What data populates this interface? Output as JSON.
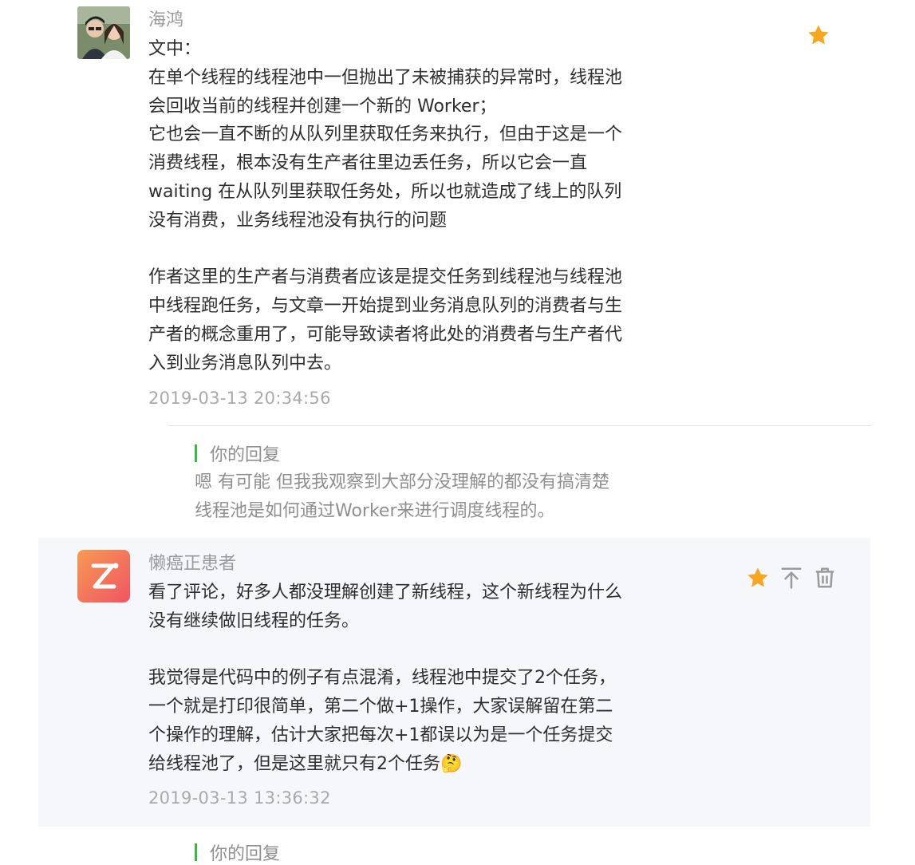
{
  "comments": [
    {
      "author": "海鸿",
      "content": "文中：\n在单个线程的线程池中一但抛出了未被捕获的异常时，线程池会回收当前的线程并创建一个新的 Worker；\n它也会一直不断的从队列里获取任务来执行，但由于这是一个消费线程，根本没有生产者往里边丢任务，所以它会一直 waiting 在从队列里获取任务处，所以也就造成了线上的队列没有消费，业务线程池没有执行的问题\n\n作者这里的生产者与消费者应该是提交任务到线程池与线程池中线程跑任务，与文章一开始提到业务消息队列的消费者与生产者的概念重用了，可能导致读者将此处的消费者与生产者代入到业务消息队列中去。",
      "time": "2019-03-13 20:34:56",
      "reply": {
        "label": "你的回复",
        "text": "嗯 有可能 但我我观察到大部分没理解的都没有搞清楚\n线程池是如何通过Worker来进行调度线程的。"
      }
    },
    {
      "author": "懒癌正患者",
      "content": "看了评论，好多人都没理解创建了新线程，这个新线程为什么没有继续做旧线程的任务。\n\n我觉得是代码中的例子有点混淆，线程池中提交了2个任务，一个就是打印很简单，第二个做+1操作，大家误解留在第二个操作的理解，估计大家把每次+1都误以为是一个任务提交给线程池了，但是这里就只有2个任务🤔",
      "time": "2019-03-13 13:36:32",
      "reply": {
        "label": "你的回复"
      }
    }
  ],
  "colors": {
    "star": "#f5a623",
    "reply_bar": "#3fb549",
    "icon_gray": "#9b9b9b"
  },
  "icons": [
    "star-icon",
    "pin-top-icon",
    "trash-icon"
  ]
}
